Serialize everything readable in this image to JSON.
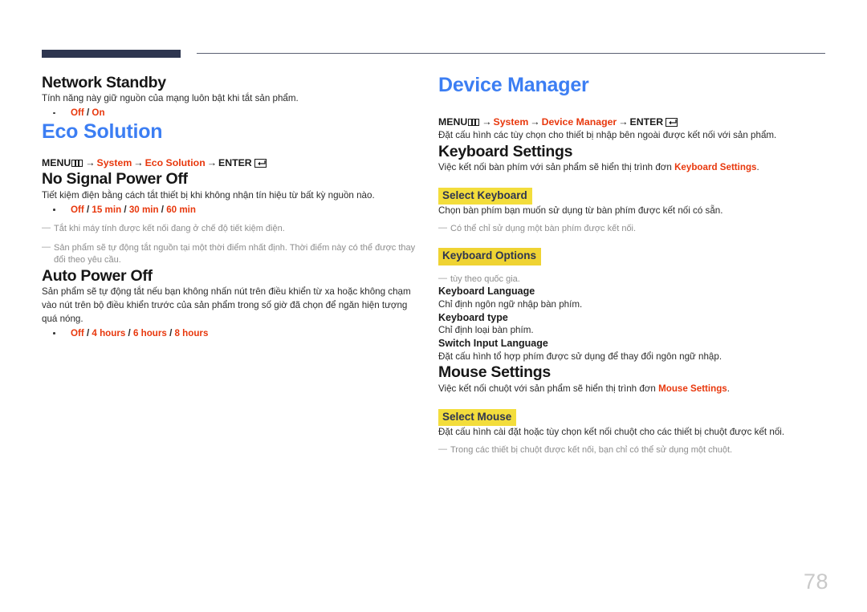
{
  "page": {
    "number": "78",
    "accent_heading_color": "#3c7ef3",
    "accent_option_color": "#e8380d",
    "highlight_color": "#f3dd3c",
    "rule_color": "#2e3650"
  },
  "icons": {
    "menu": "menu-grid-icon",
    "enter": "enter-return-icon"
  },
  "left": {
    "network_standby": {
      "title": "Network Standby",
      "body": "Tính năng này giữ nguồn của mạng luôn bật khi tắt sản phẩm.",
      "options": [
        "Off",
        "On"
      ]
    },
    "eco_solution": {
      "title": "Eco Solution",
      "path": {
        "menu_label": "MENU",
        "item1": "System",
        "item2": "Eco Solution",
        "enter_label": "ENTER",
        "arrow": "→"
      }
    },
    "no_signal_power_off": {
      "title": "No Signal Power Off",
      "body": "Tiết kiệm điện bằng cách tắt thiết bị khi không nhận tín hiệu từ bất kỳ nguồn nào.",
      "options": [
        "Off",
        "15 min",
        "30 min",
        "60 min"
      ],
      "notes": [
        "Tắt khi máy tính được kết nối đang ở chế độ tiết kiệm điện.",
        "Sản phẩm sẽ tự động tắt nguồn tại một thời điểm nhất định. Thời điểm này có thể được thay đổi theo yêu cầu."
      ]
    },
    "auto_power_off": {
      "title": "Auto Power Off",
      "body": "Sản phẩm sẽ tự động tắt nếu bạn không nhấn nút trên điều khiển từ xa hoặc không chạm vào nút trên bộ điều khiển trước của sản phẩm trong số giờ đã chọn để ngăn hiện tượng quá nóng.",
      "options": [
        "Off",
        "4 hours",
        "6 hours",
        "8 hours"
      ]
    }
  },
  "right": {
    "device_manager": {
      "title": "Device Manager",
      "path": {
        "menu_label": "MENU",
        "item1": "System",
        "item2": "Device Manager",
        "enter_label": "ENTER",
        "arrow": "→"
      },
      "body": "Đặt cấu hình các tùy chọn cho thiết bị nhập bên ngoài được kết nối với sản phẩm."
    },
    "keyboard_settings": {
      "title": "Keyboard Settings",
      "body_pre": "Việc kết nối bàn phím với sản phẩm sẽ hiển thị trình đơn ",
      "body_highlight": "Keyboard Settings",
      "body_post": ".",
      "select_keyboard": {
        "label": "Select Keyboard",
        "body": "Chọn bàn phím bạn muốn sử dụng từ bàn phím được kết nối có sẵn.",
        "note": "Có thể chỉ sử dụng một bàn phím được kết nối."
      },
      "keyboard_options": {
        "label": "Keyboard Options",
        "note": "tùy theo quốc gia."
      },
      "items": [
        {
          "title": "Keyboard Language",
          "body": "Chỉ định ngôn ngữ nhập bàn phím."
        },
        {
          "title": "Keyboard type",
          "body": "Chỉ định loại bàn phím."
        },
        {
          "title": "Switch Input Language",
          "body": "Đặt cấu hình tổ hợp phím được sử dụng để thay đổi ngôn ngữ nhập."
        }
      ]
    },
    "mouse_settings": {
      "title": "Mouse Settings",
      "body_pre": "Việc kết nối chuột với sản phẩm sẽ hiển thị trình đơn ",
      "body_highlight": "Mouse Settings",
      "body_post": ".",
      "select_mouse": {
        "label": "Select Mouse",
        "body": "Đặt cấu hình cài đặt hoặc tùy chọn kết nối chuột cho các thiết bị chuột được kết nối.",
        "note": "Trong các thiết bị chuột được kết nối, bạn chỉ có thể sử dụng một chuột."
      }
    }
  }
}
